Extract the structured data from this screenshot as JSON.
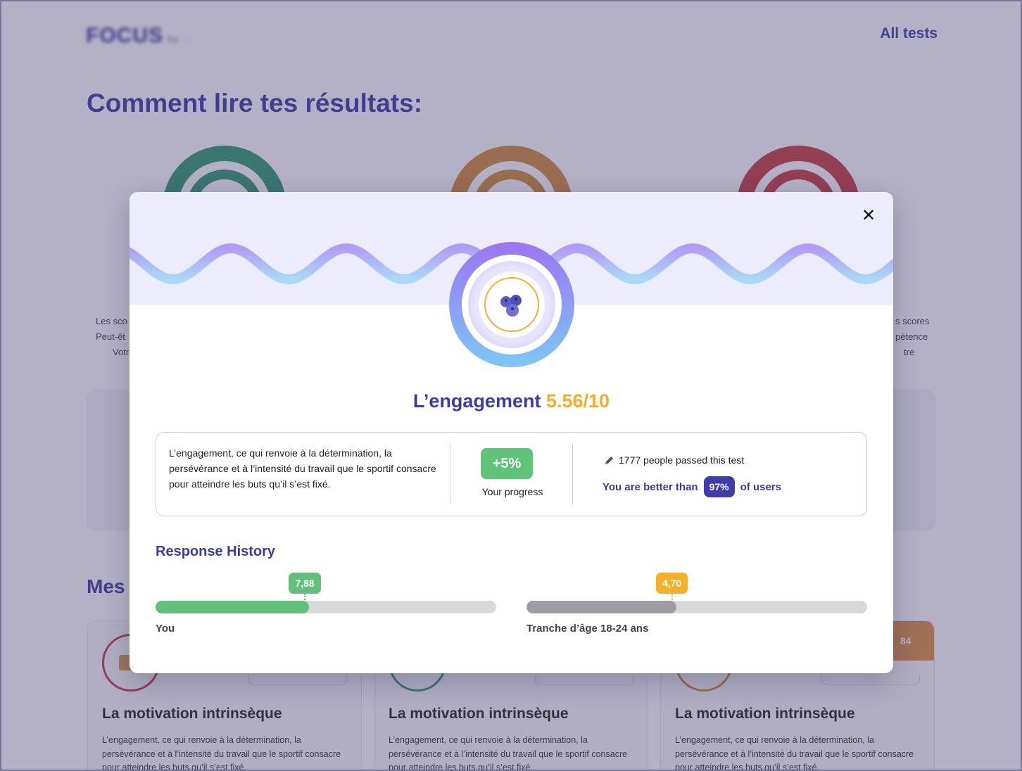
{
  "background": {
    "logo": "FOCUS",
    "logo_sub": "by ...",
    "nav_all_tests": "All tests",
    "title": "Comment lire tes résultats:",
    "text_left": [
      "Les sco",
      "Peut-êt",
      "Votr"
    ],
    "text_right": [
      "s scores",
      "pétence",
      "tre"
    ],
    "section_title": "Mes",
    "cards": [
      {
        "title": "La motivation intrinsèque",
        "desc": "L’engagement, ce qui renvoie à la détermination, la persévérance et à l’intensité du travail que le sportif consacre pour atteindre les buts qu’il s’est fixé."
      },
      {
        "title": "La motivation intrinsèque",
        "desc": "L’engagement, ce qui renvoie à la détermination, la persévérance et à l’intensité du travail que le sportif consacre pour atteindre les buts qu’il s’est fixé."
      },
      {
        "title": "La motivation intrinsèque",
        "desc": "L’engagement, ce qui renvoie à la détermination, la persévérance et à l’intensité du travail que le sportif consacre pour atteindre les buts qu’il s’est fixé.",
        "badge": "84"
      }
    ]
  },
  "modal": {
    "close_icon": "close-icon",
    "badge_icon": "blueberry-icon",
    "title_name": "L’engagement",
    "title_score": "5.56/10",
    "description": "L’engagement, ce qui renvoie à la détermination, la persévérance et à l’intensité du travail que le sportif consacre pour atteindre les buts qu’il s’est fixé.",
    "progress_value": "+5%",
    "progress_label": "Your progress",
    "people_passed": "1777 people passed this test",
    "better_prefix": "You are better than",
    "better_percent": "97%",
    "better_suffix": "of users",
    "history_title": "Response History",
    "bars": [
      {
        "label": "You",
        "value_label": "7,88",
        "value": 7.88,
        "max": 17.5,
        "color": "#62c07a"
      },
      {
        "label": "Tranche d’âge 18-24 ans",
        "value_label": "4,70",
        "value": 4.7,
        "max": 10.7,
        "color": "#9d9da3",
        "tag_color": "#f5b02b"
      }
    ]
  },
  "colors": {
    "primary": "#3b3ba6",
    "accent": "#f5ad2b",
    "success": "#62c07a"
  }
}
